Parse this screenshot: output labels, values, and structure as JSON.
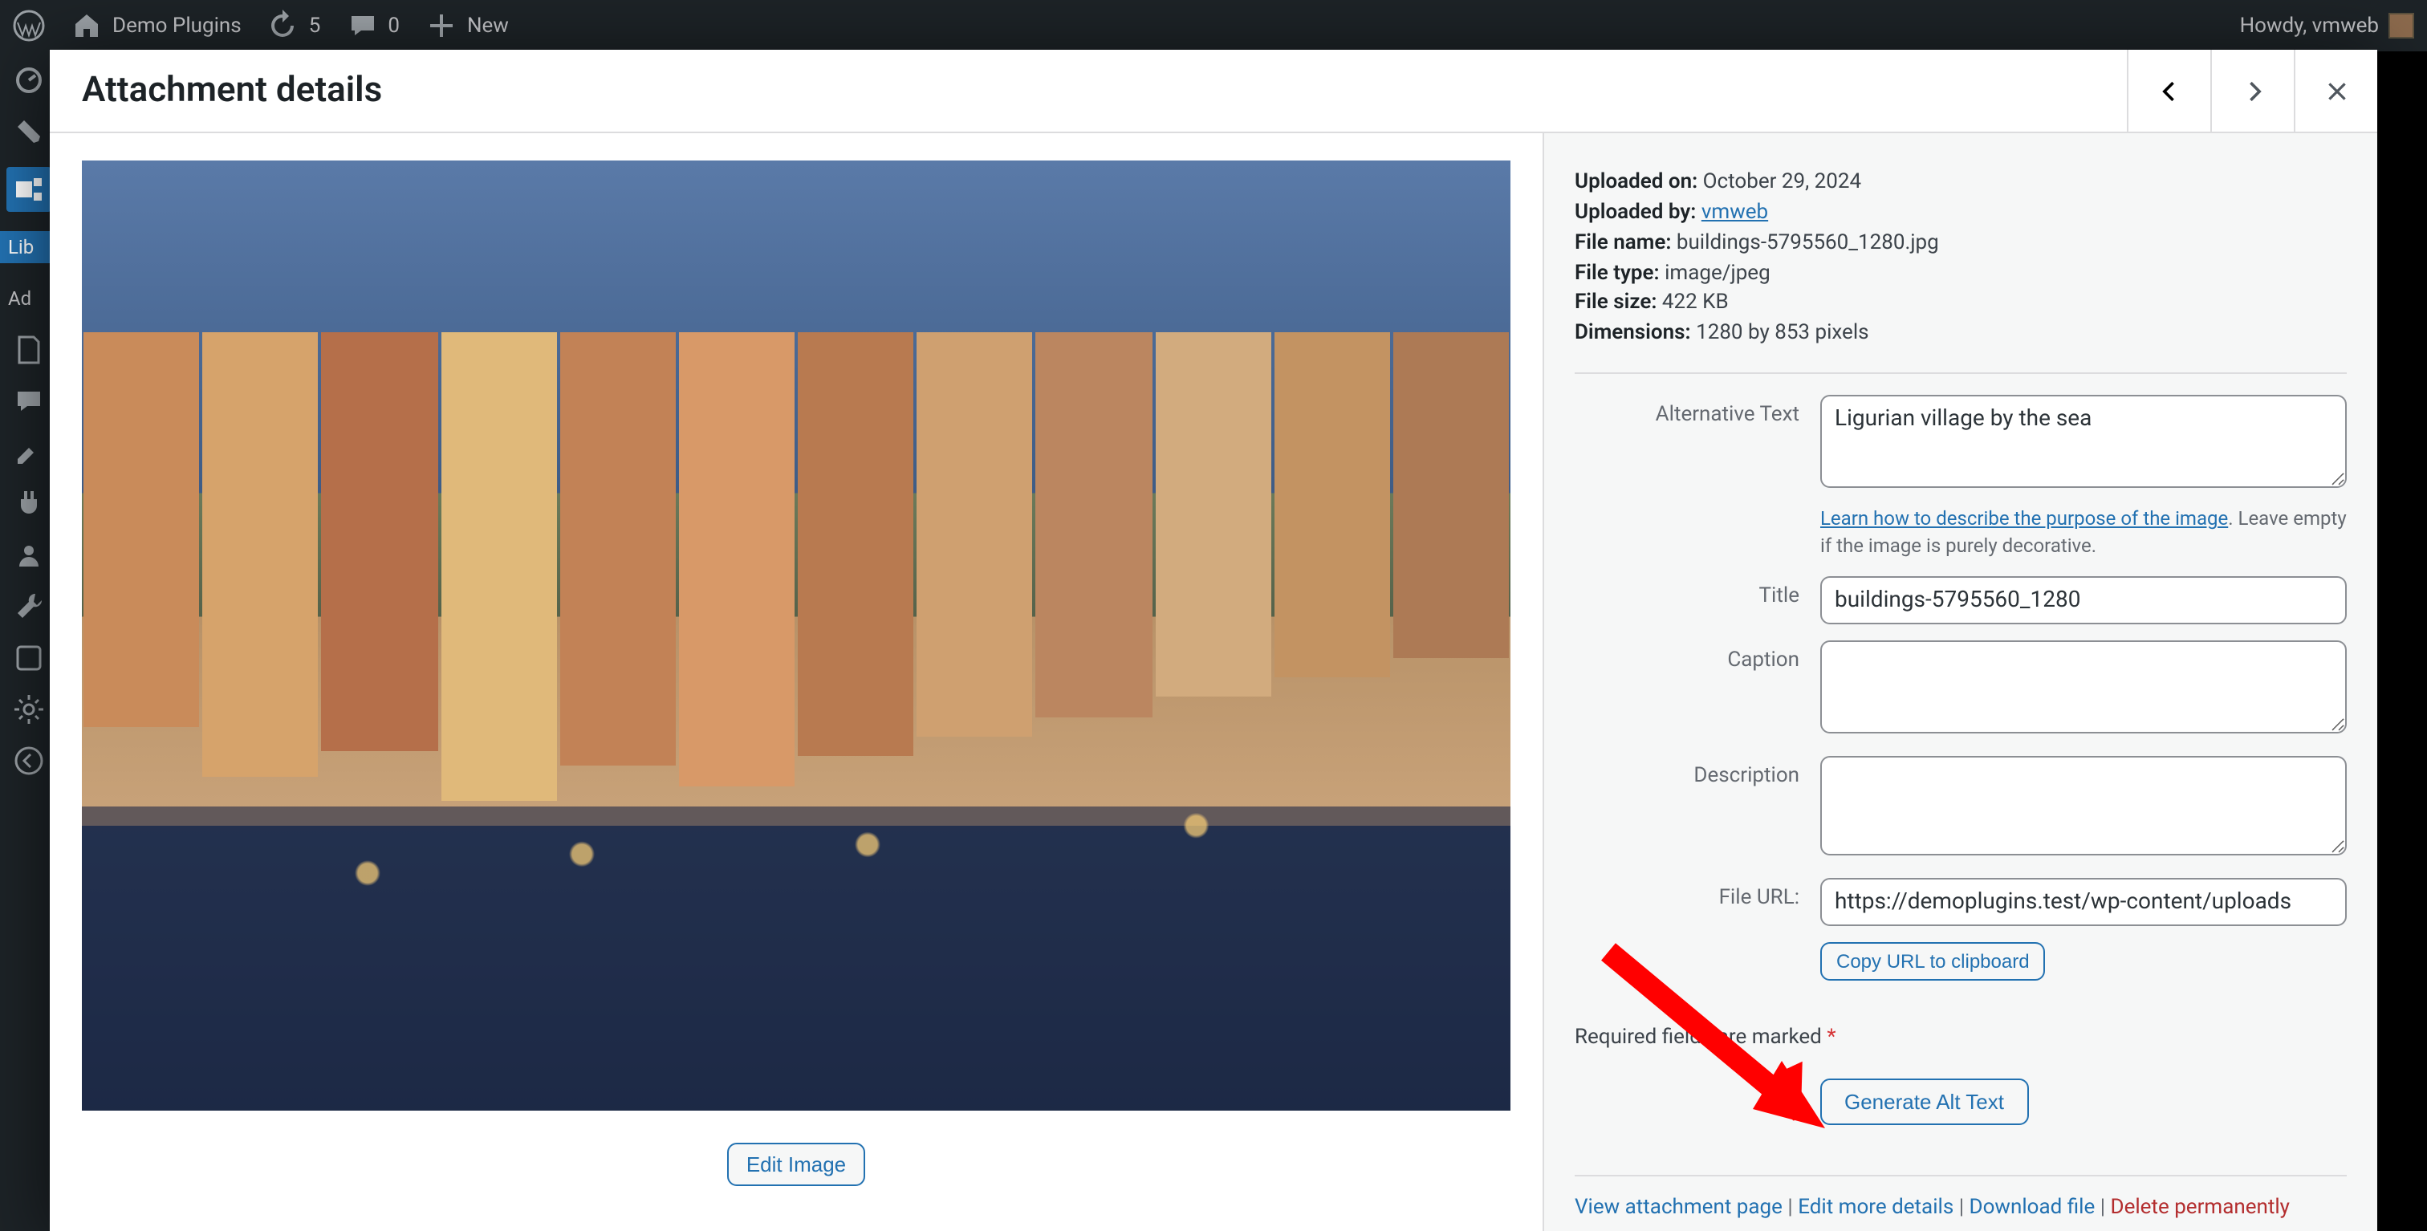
{
  "adminbar": {
    "site": "Demo Plugins",
    "updates": "5",
    "comments": "0",
    "new": "New",
    "howdy": "Howdy, vmweb"
  },
  "sidebar": {
    "library": "Lib",
    "add": "Ad"
  },
  "modal": {
    "title": "Attachment details"
  },
  "meta": {
    "uploaded_on_label": "Uploaded on:",
    "uploaded_on": "October 29, 2024",
    "uploaded_by_label": "Uploaded by:",
    "uploaded_by": "vmweb",
    "file_name_label": "File name:",
    "file_name": "buildings-5795560_1280.jpg",
    "file_type_label": "File type:",
    "file_type": "image/jpeg",
    "file_size_label": "File size:",
    "file_size": "422 KB",
    "dimensions_label": "Dimensions:",
    "dimensions": "1280 by 853 pixels"
  },
  "fields": {
    "alt_label": "Alternative Text",
    "alt_value": "Ligurian village by the sea",
    "alt_help_link": "Learn how to describe the purpose of the image",
    "alt_help_tail": ". Leave empty if the image is purely decorative.",
    "title_label": "Title",
    "title_value": "buildings-5795560_1280",
    "caption_label": "Caption",
    "caption_value": "",
    "description_label": "Description",
    "description_value": "",
    "file_url_label": "File URL:",
    "file_url_value": "https://demoplugins.test/wp-content/uploads",
    "copy_url": "Copy URL to clipboard",
    "required_note": "Required fields are marked",
    "asterisk": "*",
    "generate_alt": "Generate Alt Text",
    "edit_image": "Edit Image"
  },
  "footer": {
    "view": "View attachment page",
    "edit_more": "Edit more details",
    "download": "Download file",
    "delete": "Delete permanently",
    "sep": " | "
  }
}
